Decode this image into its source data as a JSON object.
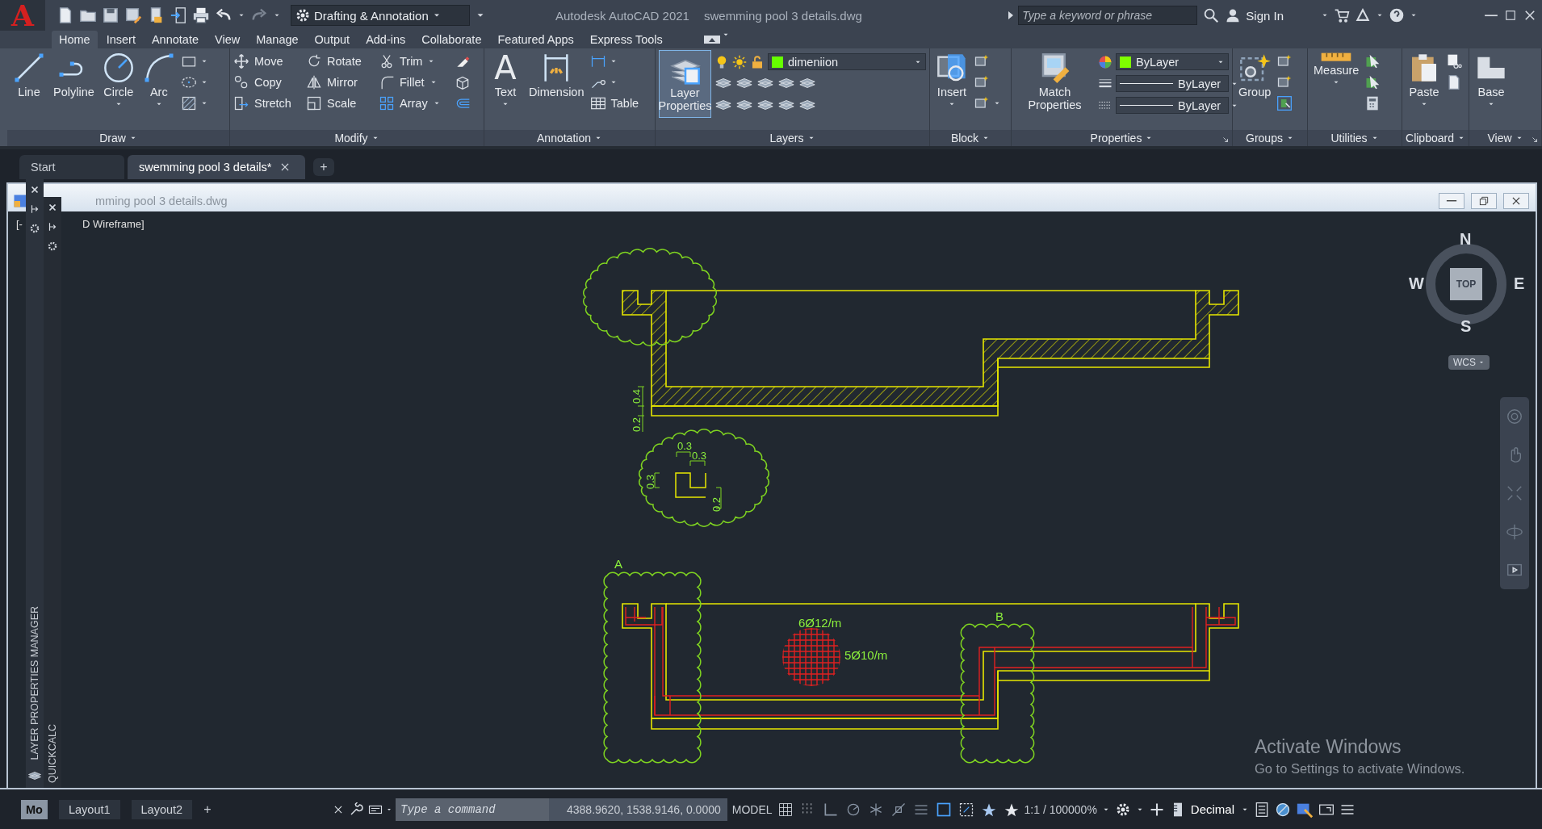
{
  "app": {
    "logo": "A",
    "workspace": "Drafting & Annotation",
    "title": "Autodesk AutoCAD 2021",
    "document": "swemming pool 3 details.dwg",
    "search": {
      "placeholder": "Type a keyword or phrase"
    },
    "user": "Sign In"
  },
  "ribbon_tabs": [
    {
      "label": "Home",
      "selected": true
    },
    {
      "label": "Insert",
      "selected": false
    },
    {
      "label": "Annotate",
      "selected": false
    },
    {
      "label": "View",
      "selected": false
    },
    {
      "label": "Manage",
      "selected": false
    },
    {
      "label": "Output",
      "selected": false
    },
    {
      "label": "Add-ins",
      "selected": false
    },
    {
      "label": "Collaborate",
      "selected": false
    },
    {
      "label": "Featured Apps",
      "selected": false
    },
    {
      "label": "Express Tools",
      "selected": false
    }
  ],
  "panels": [
    {
      "kind": "draw",
      "title": "Draw",
      "buttons": [
        {
          "label": "Line",
          "has_menu": false
        },
        {
          "label": "Polyline",
          "has_menu": false
        },
        {
          "label": "Circle",
          "has_menu": true
        },
        {
          "label": "Arc",
          "has_menu": true
        }
      ]
    },
    {
      "kind": "modify",
      "title": "Modify",
      "tools": [
        {
          "label": "Move",
          "has_menu": false
        },
        {
          "label": "Rotate",
          "has_menu": false
        },
        {
          "label": "Trim",
          "has_menu": true
        },
        {
          "label": "Copy",
          "has_menu": false
        },
        {
          "label": "Mirror",
          "has_menu": false
        },
        {
          "label": "Fillet",
          "has_menu": true
        },
        {
          "label": "Stretch",
          "has_menu": false
        },
        {
          "label": "Scale",
          "has_menu": false
        },
        {
          "label": "Array",
          "has_menu": true
        }
      ]
    },
    {
      "kind": "annotation",
      "title": "Annotation",
      "buttons": [
        {
          "label": "Text",
          "glyph": "A",
          "has_menu": true
        },
        {
          "label": "Dimension",
          "has_menu": false
        }
      ],
      "tools": [
        {
          "label": "Table",
          "has_menu": false
        }
      ]
    },
    {
      "kind": "layers",
      "title": "Layers",
      "buttons": [
        {
          "label": "Layer Properties",
          "highlighted": true
        }
      ],
      "layer": {
        "name": "dimeniion",
        "color": "#66ff00"
      }
    },
    {
      "kind": "block",
      "title": "Block",
      "buttons": [
        {
          "label": "Insert",
          "has_menu": true
        }
      ]
    },
    {
      "kind": "properties",
      "title": "Properties",
      "buttons": [
        {
          "label": "Match Properties",
          "has_menu": false
        }
      ],
      "dropdowns": [
        {
          "value": "ByLayer",
          "color": "#7fff00"
        },
        {
          "value": "ByLayer"
        },
        {
          "value": "ByLayer"
        }
      ]
    },
    {
      "kind": "groups",
      "title": "Groups",
      "buttons": [
        {
          "label": "Group",
          "has_menu": false
        }
      ]
    },
    {
      "kind": "utilities",
      "title": "Utilities",
      "buttons": [
        {
          "label": "Measure",
          "has_menu": true
        }
      ]
    },
    {
      "kind": "clipboard",
      "title": "Clipboard",
      "buttons": [
        {
          "label": "Paste",
          "has_menu": true
        }
      ]
    },
    {
      "kind": "view",
      "title": "View",
      "buttons": [
        {
          "label": "Base",
          "has_menu": true
        }
      ]
    }
  ],
  "doc_tabs": [
    {
      "label": "Start",
      "selected": false
    },
    {
      "label": "swemming pool 3 details*",
      "selected": true
    }
  ],
  "new_tab": "+",
  "viewport": {
    "window_title": "mming pool 3 details.dwg",
    "label_start": "[-",
    "label_end": "D Wireframe]"
  },
  "palettes": [
    "LAYER PROPERTIES MANAGER",
    "QUICKCALC"
  ],
  "drawing": {
    "section_dims": [
      "0.4",
      "0.2"
    ],
    "detail_dims": [
      "0.3",
      "0.3",
      "0.3",
      "0.2"
    ],
    "cloud_labels": [
      "A",
      "B"
    ],
    "rebar_labels": [
      "6Ø12/m",
      "5Ø10/m"
    ]
  },
  "viewcube": {
    "north": "N",
    "south": "S",
    "west": "W",
    "east": "E",
    "face": "TOP",
    "ucs": "WCS"
  },
  "notice": {
    "title": "Activate Windows",
    "text": "Go to Settings to activate Windows."
  },
  "layout_tabs": [
    {
      "label": "Mo",
      "selected": true
    },
    {
      "label": "Layout1",
      "selected": false
    },
    {
      "label": "Layout2",
      "selected": false
    }
  ],
  "add_layout": "+",
  "status": {
    "command_placeholder": "Type a command",
    "coordinates": "4388.9620, 1538.9146, 0.0000",
    "space": "MODEL",
    "scale": "1:1 / 100000%",
    "units": "Decimal"
  }
}
